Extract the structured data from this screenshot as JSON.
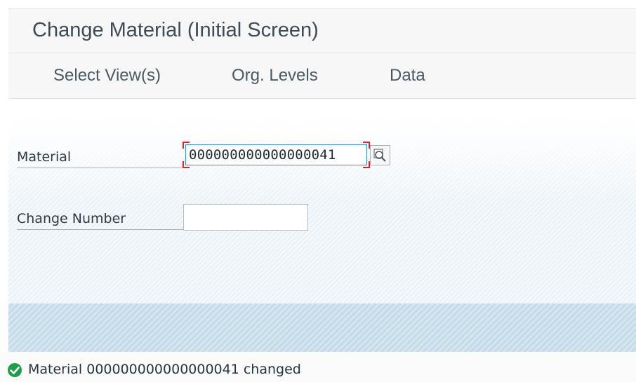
{
  "window": {
    "title": "Change Material (Initial Screen)"
  },
  "toolbar": {
    "items": [
      {
        "label": "Select View(s)"
      },
      {
        "label": "Org. Levels"
      },
      {
        "label": "Data"
      }
    ]
  },
  "form": {
    "material": {
      "label": "Material",
      "value": "000000000000000041",
      "help_icon": "value-help-icon"
    },
    "change_number": {
      "label": "Change Number",
      "value": ""
    }
  },
  "status": {
    "icon": "success-check-icon",
    "icon_color": "#1f9e49",
    "message": "Material 000000000000000041 changed"
  },
  "colors": {
    "focus_border": "#3a8fd4",
    "focus_corners": "#d9262b",
    "title_text": "#3f4b56"
  }
}
